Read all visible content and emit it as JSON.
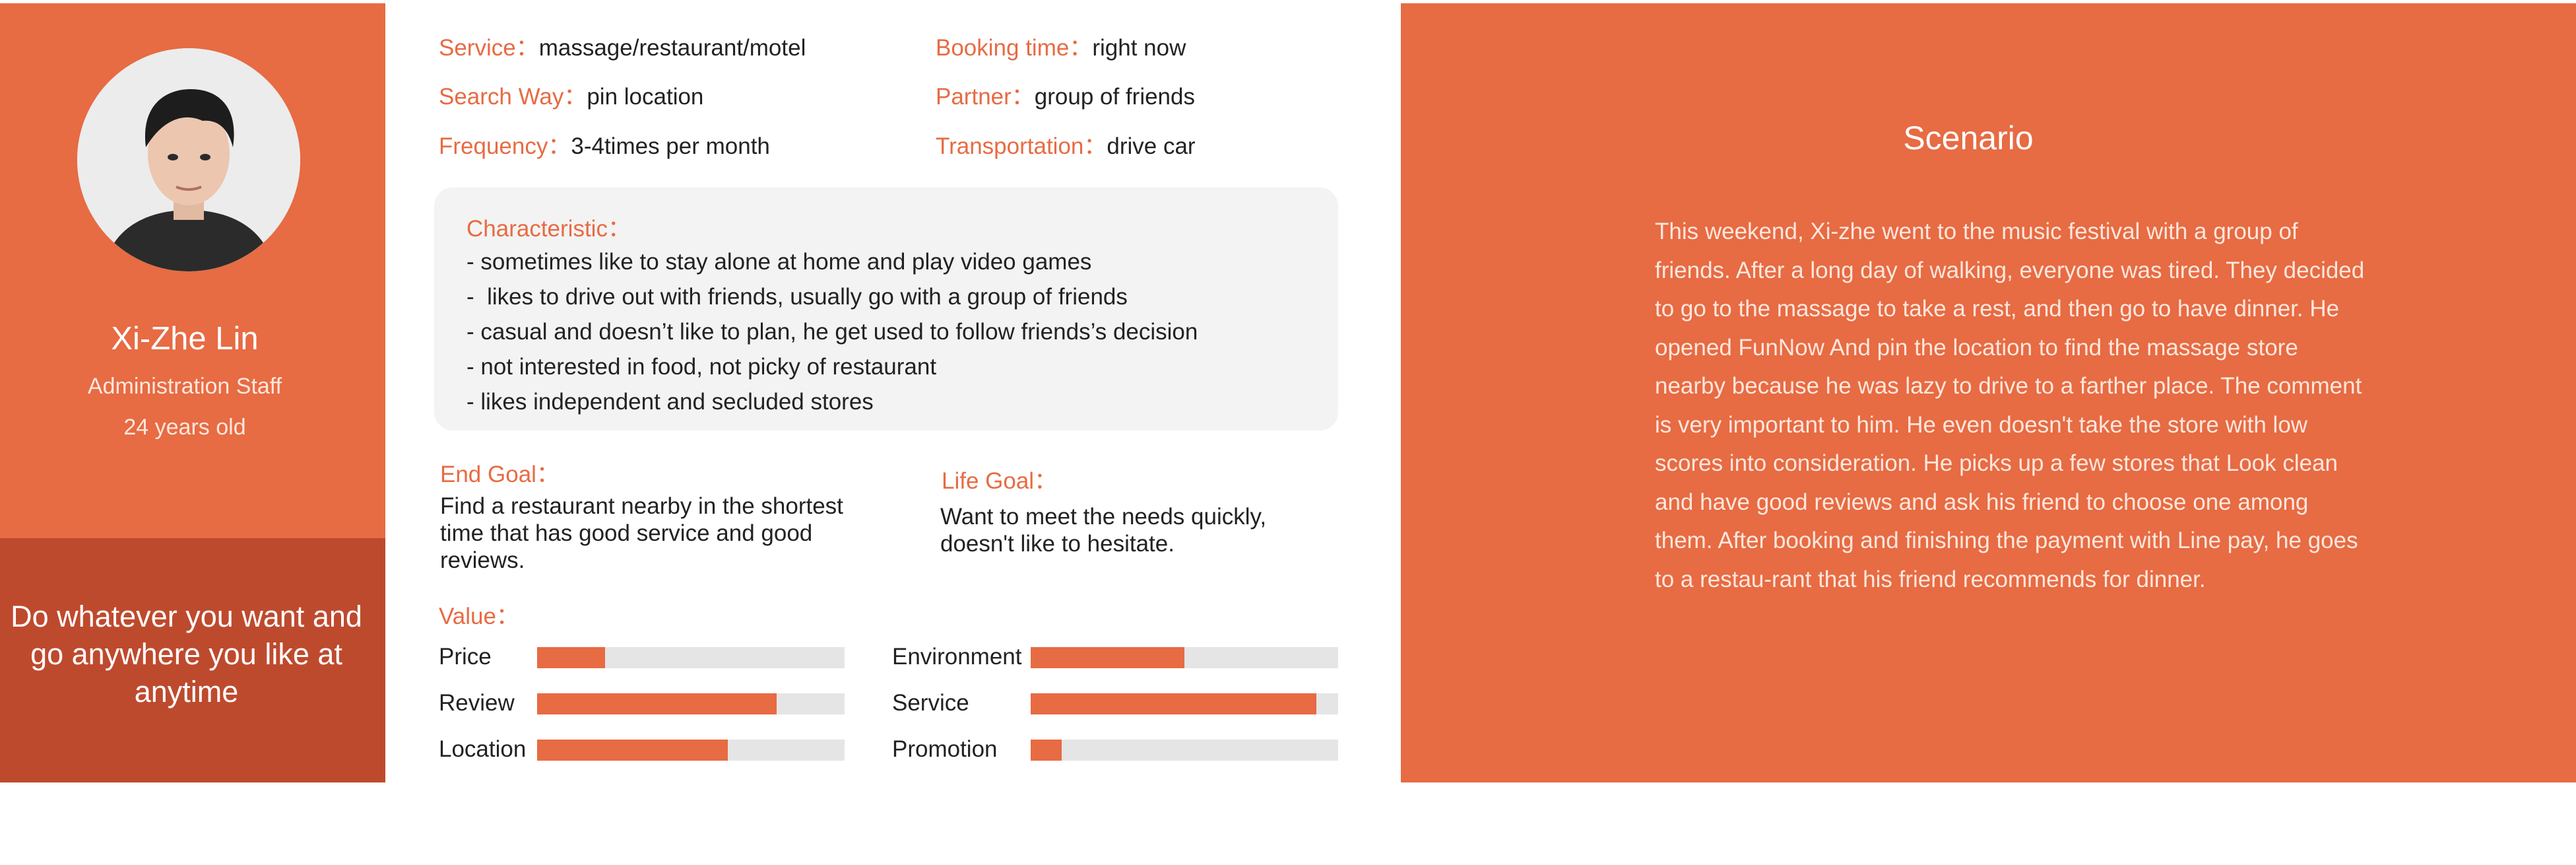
{
  "persona": {
    "name": "Xi-Zhe Lin",
    "role": "Administration Staff",
    "age": "24 years old",
    "motto": "Do whatever you want and go anywhere you like at anytime"
  },
  "info": {
    "service": {
      "label": "Service：",
      "value": "massage/restaurant/motel"
    },
    "search_way": {
      "label": "Search Way：",
      "value": "pin location"
    },
    "frequency": {
      "label": "Frequency：",
      "value": "3-4times per month"
    },
    "booking_time": {
      "label": "Booking time：",
      "value": "right now"
    },
    "partner": {
      "label": "Partner：",
      "value": "group of friends"
    },
    "transportation": {
      "label": "Transportation：",
      "value": "drive car"
    }
  },
  "characteristic": {
    "title": "Characteristic：",
    "items": [
      "- sometimes like to stay alone at home and play video games",
      "-  likes to drive out with friends, usually go with a group of friends",
      "- casual and doesn’t like to plan, he get used to follow friends’s decision",
      "- not interested in food, not picky of restaurant",
      "- likes independent and secluded stores"
    ]
  },
  "end_goal": {
    "title": "End Goal：",
    "text": "Find a restaurant nearby in the shortest time that has good service and good reviews."
  },
  "life_goal": {
    "title": "Life Goal：",
    "text": "Want to meet the needs quickly, doesn't like to hesitate."
  },
  "value": {
    "title": "Value：",
    "bars": [
      {
        "label": "Price",
        "fraction": 0.22
      },
      {
        "label": "Review",
        "fraction": 0.78
      },
      {
        "label": "Location",
        "fraction": 0.62
      },
      {
        "label": "Environment",
        "fraction": 0.5
      },
      {
        "label": "Service",
        "fraction": 0.93
      },
      {
        "label": "Promotion",
        "fraction": 0.1
      }
    ]
  },
  "scenario": {
    "title": "Scenario",
    "text": "This weekend, Xi-zhe went to the music festival with a group of friends. After a long day of walking, everyone was tired. They decided to go to the massage to take a rest, and then go to have dinner. He opened FunNow And pin the location to find the massage store nearby because he was lazy to drive to a farther place. The comment is very important to him. He even doesn't take the store with low scores into consideration. He picks up a few stores that Look clean and have good reviews and ask his friend to choose one among them. After booking and finishing the payment with Line pay, he goes to a restau-rant that his friend recommends for dinner."
  },
  "colors": {
    "accent": "#e76b43",
    "accent_dark": "#be4a2e",
    "panel_gray": "#f3f3f3",
    "track_gray": "#e5e5e5"
  }
}
